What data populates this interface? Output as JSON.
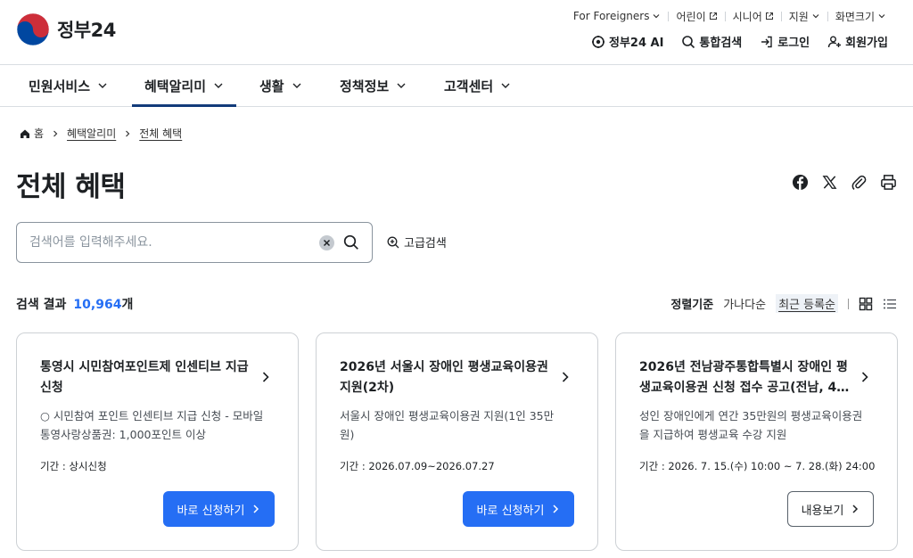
{
  "header": {
    "logo_text": "정부24",
    "utility": [
      {
        "label": "For Foreigners",
        "icon": "chevron-down-icon"
      },
      {
        "label": "어린이",
        "icon": "external-link-icon"
      },
      {
        "label": "시니어",
        "icon": "external-link-icon"
      },
      {
        "label": "지원",
        "icon": "chevron-down-icon"
      },
      {
        "label": "화면크기",
        "icon": "chevron-down-icon"
      }
    ],
    "actions": {
      "ai": "정부24 AI",
      "search": "통합검색",
      "login": "로그인",
      "signup": "회원가입"
    }
  },
  "gnb": [
    {
      "label": "민원서비스"
    },
    {
      "label": "혜택알리미",
      "active": true
    },
    {
      "label": "생활"
    },
    {
      "label": "정책정보"
    },
    {
      "label": "고객센터"
    }
  ],
  "breadcrumb": [
    "홈",
    "혜택알리미",
    "전체 혜택"
  ],
  "page_title": "전체 혜택",
  "search": {
    "placeholder": "검색어를 입력해주세요.",
    "advanced_label": "고급검색"
  },
  "results": {
    "label": "검색 결과",
    "count": "10,964",
    "unit": "개"
  },
  "sort": {
    "label": "정렬기준",
    "options": [
      "가나다순",
      "최근 등록순"
    ],
    "active": "최근 등록순"
  },
  "cards": [
    {
      "title": "통영시 시민참여포인트제 인센티브 지급 신청",
      "desc": "○ 시민참여 포인트 인센티브 지급 신청 - 모바일 통영사랑상품권: 1,000포인트 이상",
      "period": "기간 : 상시신청",
      "button": "바로 신청하기"
    },
    {
      "title": "2026년 서울시 장애인 평생교육이용권 지원(2차)",
      "desc": "서울시 장애인 평생교육이용권 지원(1인 35만원)",
      "period": "기간 : 2026.07.09~2026.07.27",
      "button": "바로 신청하기"
    },
    {
      "title": "2026년 전남광주통합특별시 장애인 평생교육이용권 신청 접수 공고(전남, 4…",
      "desc": "성인 장애인에게 연간 35만원의 평생교육이용권을 지급하여 평생교육 수강 지원",
      "period": "기간 : 2026. 7. 15.(수) 10:00 ~ 7. 28.(화) 24:00",
      "button": "내용보기"
    }
  ],
  "colors": {
    "primary": "#256ef4",
    "nav_active": "#123b7a",
    "logo_red": "#cd2e3a",
    "logo_blue": "#0047a0"
  }
}
